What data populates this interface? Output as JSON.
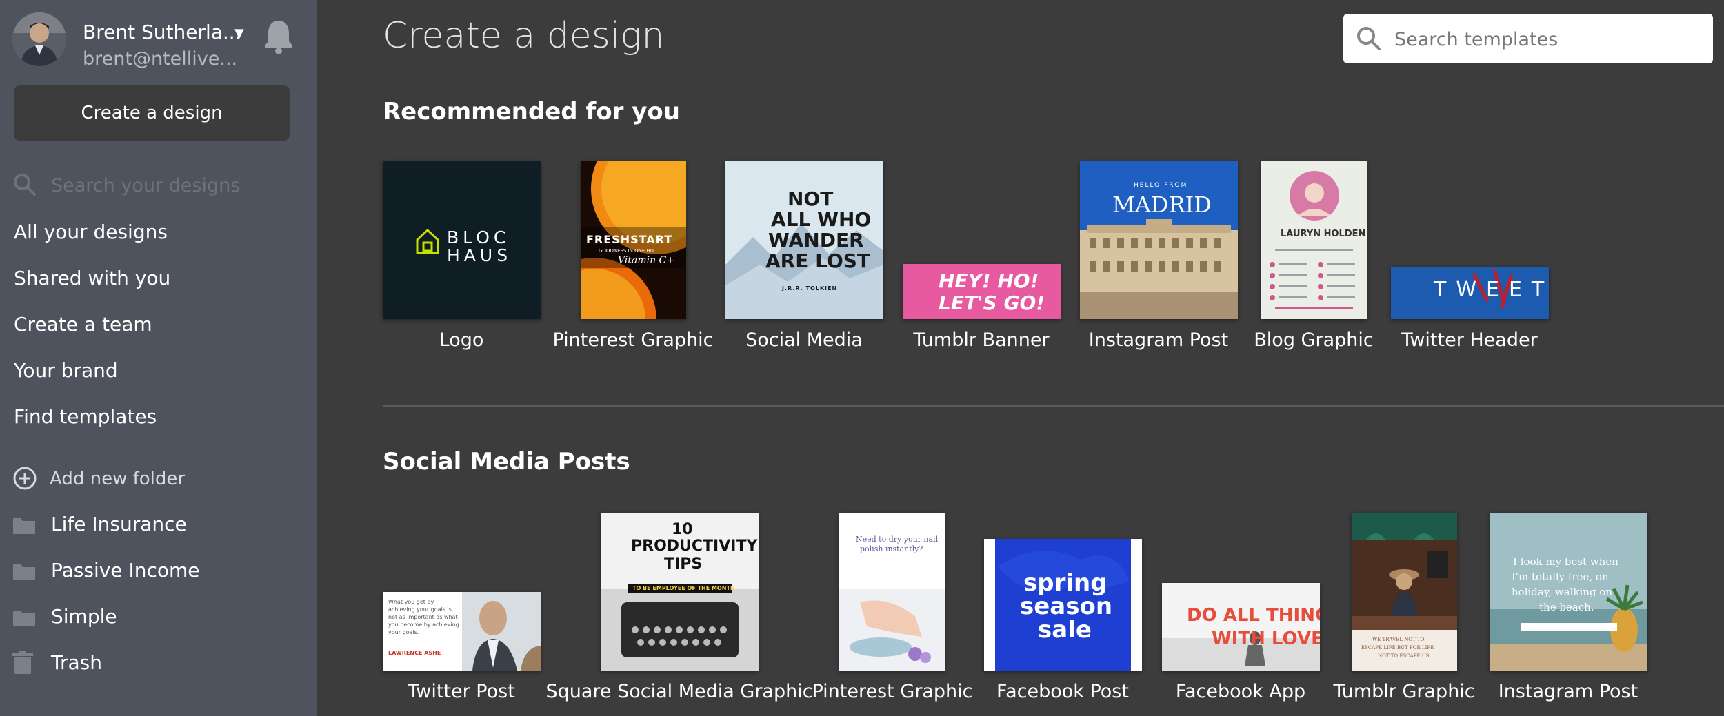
{
  "user": {
    "name": "Brent Sutherla...",
    "email": "brent@ntellive..."
  },
  "sidebar": {
    "create_label": "Create a design",
    "search_placeholder": "Search your designs",
    "nav": [
      "All your designs",
      "Shared with you",
      "Create a team",
      "Your brand",
      "Find templates"
    ],
    "add_folder_label": "Add new folder",
    "folders": [
      "Life Insurance",
      "Passive Income",
      "Simple"
    ],
    "trash_label": "Trash"
  },
  "main": {
    "title": "Create a design",
    "search_placeholder": "Search templates",
    "recommended_title": "Recommended for you",
    "recommended": [
      "Logo",
      "Pinterest Graphic",
      "Social Media",
      "Tumblr Banner",
      "Instagram Post",
      "Blog Graphic",
      "Twitter Header"
    ],
    "social_title": "Social Media Posts",
    "social": [
      "Twitter Post",
      "Square Social Media Graphic",
      "Pinterest Graphic",
      "Facebook Post",
      "Facebook App",
      "Tumblr Graphic",
      "Instagram Post"
    ]
  },
  "thumbs": {
    "logo": [
      "BLOC",
      "HAUS"
    ],
    "pinterest": [
      "FRESHSTART",
      "GOODNESS IN ONE HIT",
      "Vitamin C+"
    ],
    "social_media": [
      "NOT",
      "ALL WHO",
      "WANDER",
      "ARE LOST",
      "J.R.R. TOLKIEN"
    ],
    "tumblr_banner": [
      "HEY! HO!",
      "LET'S GO!"
    ],
    "instagram": [
      "HELLO FROM",
      "MADRID"
    ],
    "blog": [
      "LAURYN HOLDEN"
    ],
    "twitter_header": "TWEET",
    "twitter_post": [
      "What you get by",
      "achieving your goals is",
      "not as important as what",
      "you become by achieving",
      "your goals.",
      "LAWRENCE ASHE"
    ],
    "productivity": [
      "10",
      "PRODUCTIVITY",
      "TIPS",
      "TO BE EMPLOYEE OF THE MONTH"
    ],
    "pinterest2": [
      "Need to dry your nail",
      "polish instantly?"
    ],
    "facebook_post": [
      "spring",
      "season",
      "sale"
    ],
    "facebook_app": [
      "DO ALL THINGS",
      "WITH LOVE"
    ],
    "tumblr_graphic": [
      "WE TRAVEL NOT TO",
      "ESCAPE LIFE BUT FOR LIFE",
      "NOT TO ESCAPE US."
    ],
    "instagram2": [
      "I look my best when",
      "I'm totally free, on",
      "holiday, walking on",
      "the beach."
    ]
  },
  "colors": {
    "sidebar": "#4e535e",
    "main_bg": "#3c3c3c",
    "button_bg": "#3c3c3c"
  }
}
